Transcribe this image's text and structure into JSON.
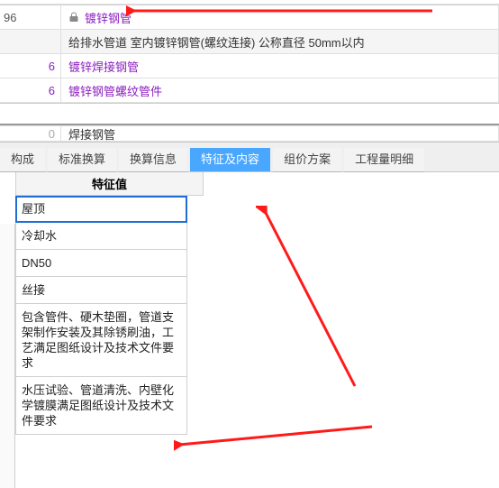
{
  "top_rows": [
    {
      "id": "r1",
      "num": "96",
      "text": "镀锌钢管",
      "link": true,
      "lock": true
    },
    {
      "id": "r2",
      "num": "",
      "text": "给排水管道  室内镀锌钢管(螺纹连接)  公称直径  50mm以内",
      "link": false,
      "lock": false,
      "gray": true
    },
    {
      "id": "r3",
      "num": "6",
      "text": "镀锌焊接钢管",
      "link": true,
      "lock": false
    },
    {
      "id": "r4",
      "num": "6",
      "text": "镀锌钢管螺纹管件",
      "link": true,
      "lock": false
    },
    {
      "id": "r5",
      "num": "0",
      "text": "焊接钢管",
      "link": false,
      "lock": false,
      "cutoff": true
    }
  ],
  "tabs": [
    {
      "id": "t0",
      "label": "构成",
      "active": false,
      "first": true
    },
    {
      "id": "t1",
      "label": "标准换算",
      "active": false
    },
    {
      "id": "t2",
      "label": "换算信息",
      "active": false
    },
    {
      "id": "t3",
      "label": "特征及内容",
      "active": true
    },
    {
      "id": "t4",
      "label": "组价方案",
      "active": false
    },
    {
      "id": "t5",
      "label": "工程量明细",
      "active": false
    }
  ],
  "feature_header": "特征值",
  "feature_rows": [
    {
      "val": "屋顶",
      "selected": true
    },
    {
      "val": "冷却水"
    },
    {
      "val": "DN50"
    },
    {
      "val": "丝接"
    },
    {
      "val": "包含管件、硬木垫圈，管道支架制作安装及其除锈刷油，工艺满足图纸设计及技术文件要求"
    },
    {
      "val": "水压试验、管道清洗、内壁化学镀膜满足图纸设计及技术文件要求"
    }
  ],
  "annotations": {
    "arrow_to_title": true,
    "arrow_to_tab": true,
    "arrow_to_lastrow": true
  }
}
